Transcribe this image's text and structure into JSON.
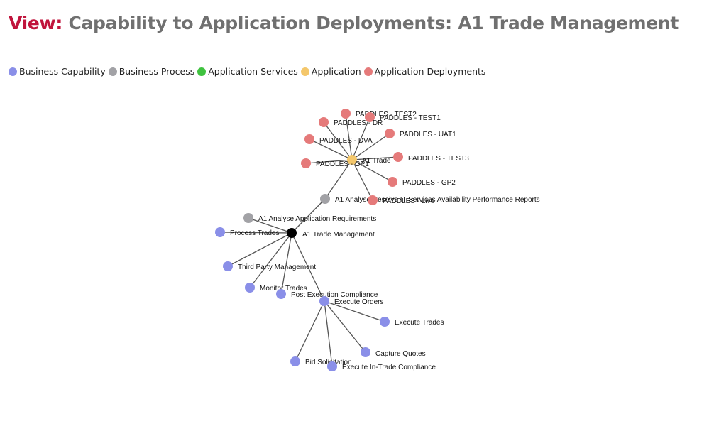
{
  "header": {
    "prefix": "View:",
    "title": "Capability to Application Deployments: A1 Trade Management"
  },
  "legend": [
    {
      "label": "Business Capability",
      "color": "#8a8fe8"
    },
    {
      "label": "Business Process",
      "color": "#a2a2a6"
    },
    {
      "label": "Application Services",
      "color": "#3fc23f"
    },
    {
      "label": "Application",
      "color": "#f4c76b"
    },
    {
      "label": "Application Deployments",
      "color": "#e57a7a"
    }
  ],
  "graph": {
    "nodes": [
      {
        "id": "a1-trade-management",
        "label": "A1 Trade Management",
        "kind": "root"
      },
      {
        "id": "a1-analyse-app-req",
        "label": "A1 Analyse Application Requirements",
        "kind": "process"
      },
      {
        "id": "process-trades",
        "label": "Process Trades",
        "kind": "capability"
      },
      {
        "id": "third-party-management",
        "label": "Third Party Management",
        "kind": "capability"
      },
      {
        "id": "monitor-trades",
        "label": "Monitor Trades",
        "kind": "capability"
      },
      {
        "id": "post-execution-compliance",
        "label": "Post Execution Compliance",
        "kind": "capability"
      },
      {
        "id": "execute-orders",
        "label": "Execute Orders",
        "kind": "capability"
      },
      {
        "id": "execute-trades",
        "label": "Execute Trades",
        "kind": "capability"
      },
      {
        "id": "capture-quotes",
        "label": "Capture Quotes",
        "kind": "capability"
      },
      {
        "id": "bid-solicitation",
        "label": "Bid Solicitation",
        "kind": "capability"
      },
      {
        "id": "execute-in-trade-compliance",
        "label": "Execute In-Trade Compliance",
        "kind": "capability"
      },
      {
        "id": "a1-analyse-process",
        "label": "A1 Analyse Resolve IT Services Availability Performance Reports",
        "kind": "process"
      },
      {
        "id": "a1-trade-app",
        "label": "A1 Trade",
        "kind": "application"
      },
      {
        "id": "paddles-test2",
        "label": "PADDLES - TEST2",
        "kind": "deployment"
      },
      {
        "id": "paddles-test1",
        "label": "PADDLES - TEST1",
        "kind": "deployment"
      },
      {
        "id": "paddles-dr",
        "label": "PADDLES - DR",
        "kind": "deployment"
      },
      {
        "id": "paddles-uat1",
        "label": "PADDLES - UAT1",
        "kind": "deployment"
      },
      {
        "id": "paddles-dva",
        "label": "PADDLES - DVA",
        "kind": "deployment"
      },
      {
        "id": "paddles-test3",
        "label": "PADDLES - TEST3",
        "kind": "deployment"
      },
      {
        "id": "paddles-gp1",
        "label": "PADDLES - GP1",
        "kind": "deployment"
      },
      {
        "id": "paddles-gp2",
        "label": "PADDLES - GP2",
        "kind": "deployment"
      },
      {
        "id": "paddles-live",
        "label": "PADDLES - Live",
        "kind": "deployment"
      }
    ],
    "links": [
      [
        "a1-trade-management",
        "a1-analyse-app-req"
      ],
      [
        "a1-trade-management",
        "process-trades"
      ],
      [
        "a1-trade-management",
        "third-party-management"
      ],
      [
        "a1-trade-management",
        "monitor-trades"
      ],
      [
        "a1-trade-management",
        "post-execution-compliance"
      ],
      [
        "a1-trade-management",
        "execute-orders"
      ],
      [
        "a1-trade-management",
        "a1-analyse-process"
      ],
      [
        "execute-orders",
        "execute-trades"
      ],
      [
        "execute-orders",
        "capture-quotes"
      ],
      [
        "execute-orders",
        "bid-solicitation"
      ],
      [
        "execute-orders",
        "execute-in-trade-compliance"
      ],
      [
        "a1-analyse-process",
        "a1-trade-app"
      ],
      [
        "a1-trade-app",
        "paddles-test2"
      ],
      [
        "a1-trade-app",
        "paddles-test1"
      ],
      [
        "a1-trade-app",
        "paddles-dr"
      ],
      [
        "a1-trade-app",
        "paddles-uat1"
      ],
      [
        "a1-trade-app",
        "paddles-dva"
      ],
      [
        "a1-trade-app",
        "paddles-test3"
      ],
      [
        "a1-trade-app",
        "paddles-gp1"
      ],
      [
        "a1-trade-app",
        "paddles-gp2"
      ],
      [
        "a1-trade-app",
        "paddles-live"
      ]
    ]
  }
}
